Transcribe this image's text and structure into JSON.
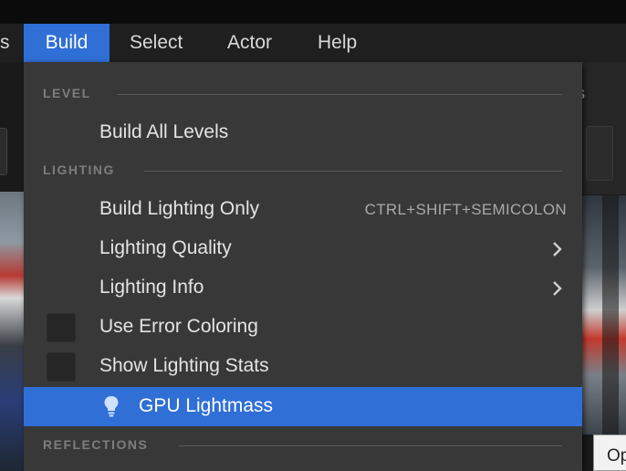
{
  "menubar": {
    "items": [
      {
        "label": "s"
      },
      {
        "label": "Build"
      },
      {
        "label": "Select"
      },
      {
        "label": "Actor"
      },
      {
        "label": "Help"
      }
    ]
  },
  "background": {
    "toolbar_fragment": "s",
    "tooltip_fragment": "Op"
  },
  "dropdown": {
    "sections": {
      "level": "LEVEL",
      "lighting": "LIGHTING",
      "reflections": "REFLECTIONS"
    },
    "items": {
      "build_all_levels": {
        "label": "Build All Levels"
      },
      "build_lighting_only": {
        "label": "Build Lighting Only",
        "shortcut": "CTRL+SHIFT+SEMICOLON"
      },
      "lighting_quality": {
        "label": "Lighting Quality"
      },
      "lighting_info": {
        "label": "Lighting Info"
      },
      "use_error_coloring": {
        "label": "Use Error Coloring",
        "checked": false
      },
      "show_lighting_stats": {
        "label": "Show Lighting Stats",
        "checked": false
      },
      "gpu_lightmass": {
        "label": "GPU Lightmass",
        "icon": "lightbulb-icon"
      }
    }
  },
  "colors": {
    "accent": "#2f6fd6",
    "menu_bg": "#383838",
    "menubar_bg": "#1f1f1f"
  }
}
